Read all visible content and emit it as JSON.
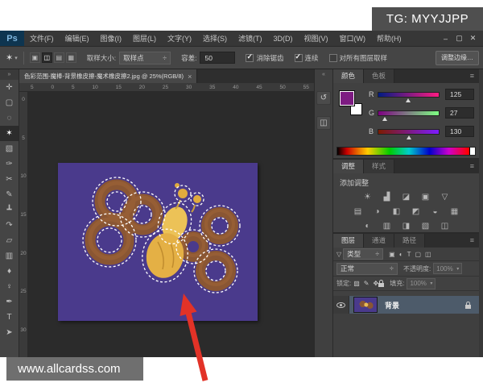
{
  "tg_box": {
    "text": "TG: MYYJJPP"
  },
  "watermark": {
    "text": "www.allcardss.com"
  },
  "menu_bar": {
    "logo": "Ps",
    "items": [
      "文件(F)",
      "编辑(E)",
      "图像(I)",
      "图层(L)",
      "文字(Y)",
      "选择(S)",
      "滤镜(T)",
      "3D(D)",
      "视图(V)",
      "窗口(W)",
      "帮助(H)"
    ],
    "window_controls": [
      {
        "name": "minimize-button",
        "glyph": "–"
      },
      {
        "name": "maximize-button",
        "glyph": "▢"
      },
      {
        "name": "close-button",
        "glyph": "✕"
      }
    ]
  },
  "options_bar": {
    "tool_icon_glyph": "✶",
    "tool_caret": "▾",
    "mode_icons": [
      {
        "name": "new-selection-icon",
        "glyph": "▣"
      },
      {
        "name": "add-to-selection-icon",
        "glyph": "◫"
      },
      {
        "name": "subtract-from-selection-icon",
        "glyph": "▤"
      },
      {
        "name": "intersect-selection-icon",
        "glyph": "▦"
      }
    ],
    "sample_size_label": "取样大小:",
    "sample_size_value": "取样点",
    "dropdown_caret": "÷",
    "tolerance_label": "容差:",
    "tolerance_value": "50",
    "checkboxes": [
      {
        "label": "消除锯齿",
        "mark": "✓"
      },
      {
        "label": "连续",
        "mark": "✓"
      },
      {
        "label": "对所有图层取样",
        "mark": ""
      }
    ],
    "refine_edge_label": "调整边缘…"
  },
  "document": {
    "tab_title": "色彩范围-魔棒-背景橡皮擦-魔术橡皮擦2.jpg @ 25%(RGB/8)",
    "tab_close": "×",
    "h_ruler": [
      "5",
      "0",
      "5",
      "10",
      "15",
      "20",
      "25",
      "30",
      "35",
      "40",
      "45",
      "50",
      "55"
    ],
    "v_ruler": [
      "0",
      "5",
      "10",
      "15",
      "20",
      "25",
      "30"
    ]
  },
  "toolbar": {
    "collapse_glyph": "»",
    "tools": [
      {
        "name": "move-tool",
        "glyph": "✛"
      },
      {
        "name": "marquee-tool",
        "glyph": "▢"
      },
      {
        "name": "lasso-tool",
        "glyph": "◌"
      },
      {
        "name": "magic-wand-tool",
        "glyph": "✶",
        "selected": true
      },
      {
        "name": "crop-tool",
        "glyph": "▧"
      },
      {
        "name": "eyedropper-tool",
        "glyph": "✑"
      },
      {
        "name": "spot-healing-brush-tool",
        "glyph": "✂"
      },
      {
        "name": "brush-tool",
        "glyph": "✎"
      },
      {
        "name": "clone-stamp-tool",
        "glyph": "┻"
      },
      {
        "name": "history-brush-tool",
        "glyph": "↷"
      },
      {
        "name": "eraser-tool",
        "glyph": "▱"
      },
      {
        "name": "gradient-tool",
        "glyph": "▥"
      },
      {
        "name": "blur-tool",
        "glyph": "♦"
      },
      {
        "name": "dodge-tool",
        "glyph": "♀"
      },
      {
        "name": "pen-tool",
        "glyph": "✒"
      },
      {
        "name": "type-tool",
        "glyph": "T"
      },
      {
        "name": "path-selection-tool",
        "glyph": "➤"
      }
    ]
  },
  "dock_strip": {
    "collapse_glyph": "«",
    "icons": [
      {
        "name": "history-panel-icon",
        "glyph": "↺"
      },
      {
        "name": "properties-panel-icon",
        "glyph": "◫"
      }
    ]
  },
  "color_panel": {
    "tabs": [
      "颜色",
      "色板"
    ],
    "menu_icon": "≡",
    "foreground_hex": "#7d1b82",
    "channels": [
      {
        "label": "R",
        "value": "125",
        "pct": 49
      },
      {
        "label": "G",
        "value": "27",
        "pct": 11
      },
      {
        "label": "B",
        "value": "130",
        "pct": 51
      }
    ]
  },
  "adjustments_panel": {
    "tabs": [
      "调整",
      "样式"
    ],
    "menu_icon": "≡",
    "title": "添加调整",
    "row1": [
      {
        "name": "brightness-contrast-icon",
        "glyph": "☀"
      },
      {
        "name": "levels-icon",
        "glyph": "▟"
      },
      {
        "name": "curves-icon",
        "glyph": "◪"
      },
      {
        "name": "exposure-icon",
        "glyph": "▣"
      },
      {
        "name": "vibrance-icon",
        "glyph": "▽"
      }
    ],
    "row2": [
      {
        "name": "hue-saturation-icon",
        "glyph": "▤"
      },
      {
        "name": "color-balance-icon",
        "glyph": "◑"
      },
      {
        "name": "black-white-icon",
        "glyph": "◧"
      },
      {
        "name": "photo-filter-icon",
        "glyph": "◩"
      },
      {
        "name": "channel-mixer-icon",
        "glyph": "◒"
      },
      {
        "name": "color-lookup-icon",
        "glyph": "▦"
      }
    ],
    "row3": [
      {
        "name": "invert-icon",
        "glyph": "◐"
      },
      {
        "name": "posterize-icon",
        "glyph": "▥"
      },
      {
        "name": "threshold-icon",
        "glyph": "◨"
      },
      {
        "name": "gradient-map-icon",
        "glyph": "▧"
      },
      {
        "name": "selective-color-icon",
        "glyph": "◫"
      }
    ]
  },
  "layers_panel": {
    "tabs": [
      "图层",
      "通道",
      "路径"
    ],
    "menu_icon": "≡",
    "filter_funnel_glyph": "▽",
    "filter_label": "类型",
    "filter_icons": [
      {
        "name": "filter-pixel-layers-icon",
        "glyph": "▣"
      },
      {
        "name": "filter-adjustment-layers-icon",
        "glyph": "◐"
      },
      {
        "name": "filter-type-layers-icon",
        "glyph": "T"
      },
      {
        "name": "filter-shape-layers-icon",
        "glyph": "▢"
      },
      {
        "name": "filter-smart-objects-icon",
        "glyph": "◫"
      }
    ],
    "blend_mode": "正常",
    "opacity_label": "不透明度:",
    "opacity_value": "100%",
    "lock_label": "锁定:",
    "lock_icons": [
      {
        "name": "lock-transparency-icon",
        "glyph": "▨"
      },
      {
        "name": "lock-pixels-icon",
        "glyph": "✎"
      },
      {
        "name": "lock-position-icon",
        "glyph": "✥"
      }
    ],
    "fill_label": "填充:",
    "fill_value": "100%",
    "layers": [
      {
        "name": "背景",
        "locked": true,
        "visible": true
      }
    ]
  },
  "canvas_image": {
    "background_hex": "#4a3a8c",
    "pretzel_hex": "#8a5633",
    "body_hex": "#e8bb55",
    "selection": "marching-ants"
  },
  "annotation": {
    "arrow_color": "#e23227"
  }
}
